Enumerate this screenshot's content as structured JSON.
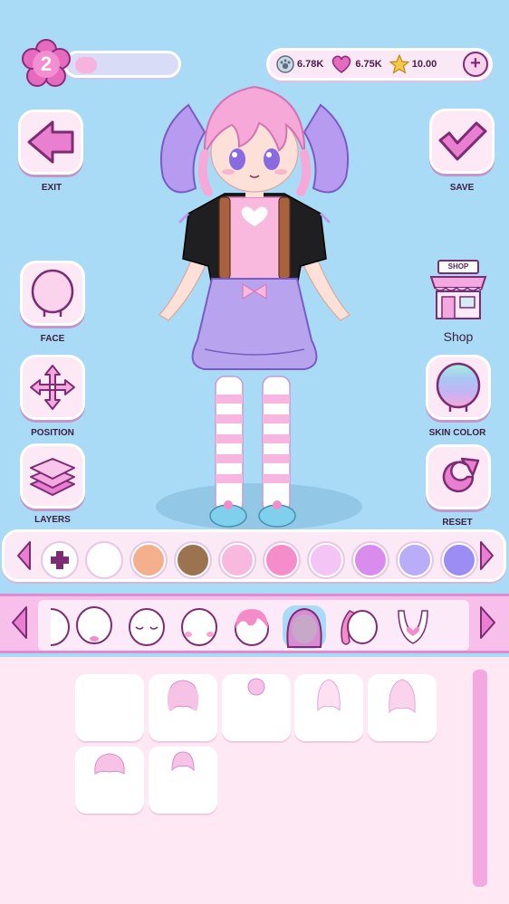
{
  "level": {
    "number": "2",
    "progress": 0.2
  },
  "currency": {
    "paws": "6.78K",
    "hearts": "6.75K",
    "stars": "10.00",
    "add_label": "+"
  },
  "left_buttons": {
    "exit": "EXIT",
    "face": "FACE",
    "position": "POSITION",
    "layers": "LAYERS"
  },
  "right_buttons": {
    "save": "SAVE",
    "shop": "Shop",
    "shop_sign": "SHOP",
    "skin_color": "SKIN COLOR",
    "reset": "RESET"
  },
  "colors": {
    "accent": "#e97fd0",
    "swatches": [
      "#ffffff",
      "#f4b08c",
      "#9b7350",
      "#f9b8dd",
      "#f58dcb",
      "#f4c4f6",
      "#d98bee",
      "#b9adf9",
      "#9c8df4"
    ]
  },
  "categories": [
    "face-partial",
    "face-plain",
    "face-closed-eyes",
    "face-blush",
    "hair-short-pink",
    "hair-long-purple",
    "hair-side",
    "necklace-heart"
  ],
  "selected_category_index": 5
}
